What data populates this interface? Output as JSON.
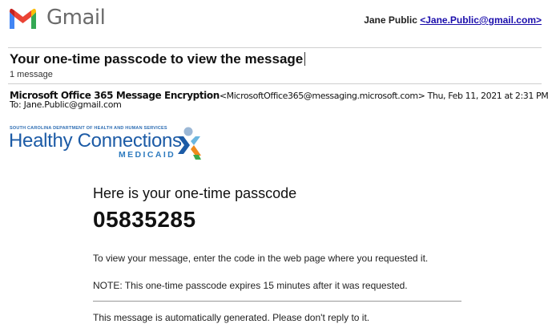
{
  "header": {
    "logo_icon": "gmail-m-icon",
    "wordmark": "Gmail",
    "user_name": "Jane Public",
    "user_email_display": "<Jane.Public@gmail.com>"
  },
  "message": {
    "subject": "Your one-time passcode to view the message",
    "count": "1  message",
    "sender_name": "Microsoft Office 365 Message Encryption",
    "sender_email_display": "<MicrosoftOffice365@messaging.microsoft.com>",
    "date": "Thu, Feb 11, 2021 at 2:31 PM",
    "to": "To: Jane.Public@gmail.com"
  },
  "brand": {
    "dept": "SOUTH CAROLINA DEPARTMENT OF HEALTH AND HUMAN SERVICES",
    "title": "Healthy Connections",
    "subtitle": "MEDICAID",
    "mark_icon": "healthy-connections-x-icon"
  },
  "body": {
    "heading": "Here is your one-time passcode",
    "passcode": "05835285",
    "instruction": "To view your message, enter the code in the web page where you requested it.",
    "note": "NOTE: This one-time passcode expires 15 minutes after it was requested.",
    "footer": "This message is automatically generated. Please don't reply to  it."
  },
  "colors": {
    "brand_blue": "#1c5ba6",
    "link": "#1a0dab"
  }
}
